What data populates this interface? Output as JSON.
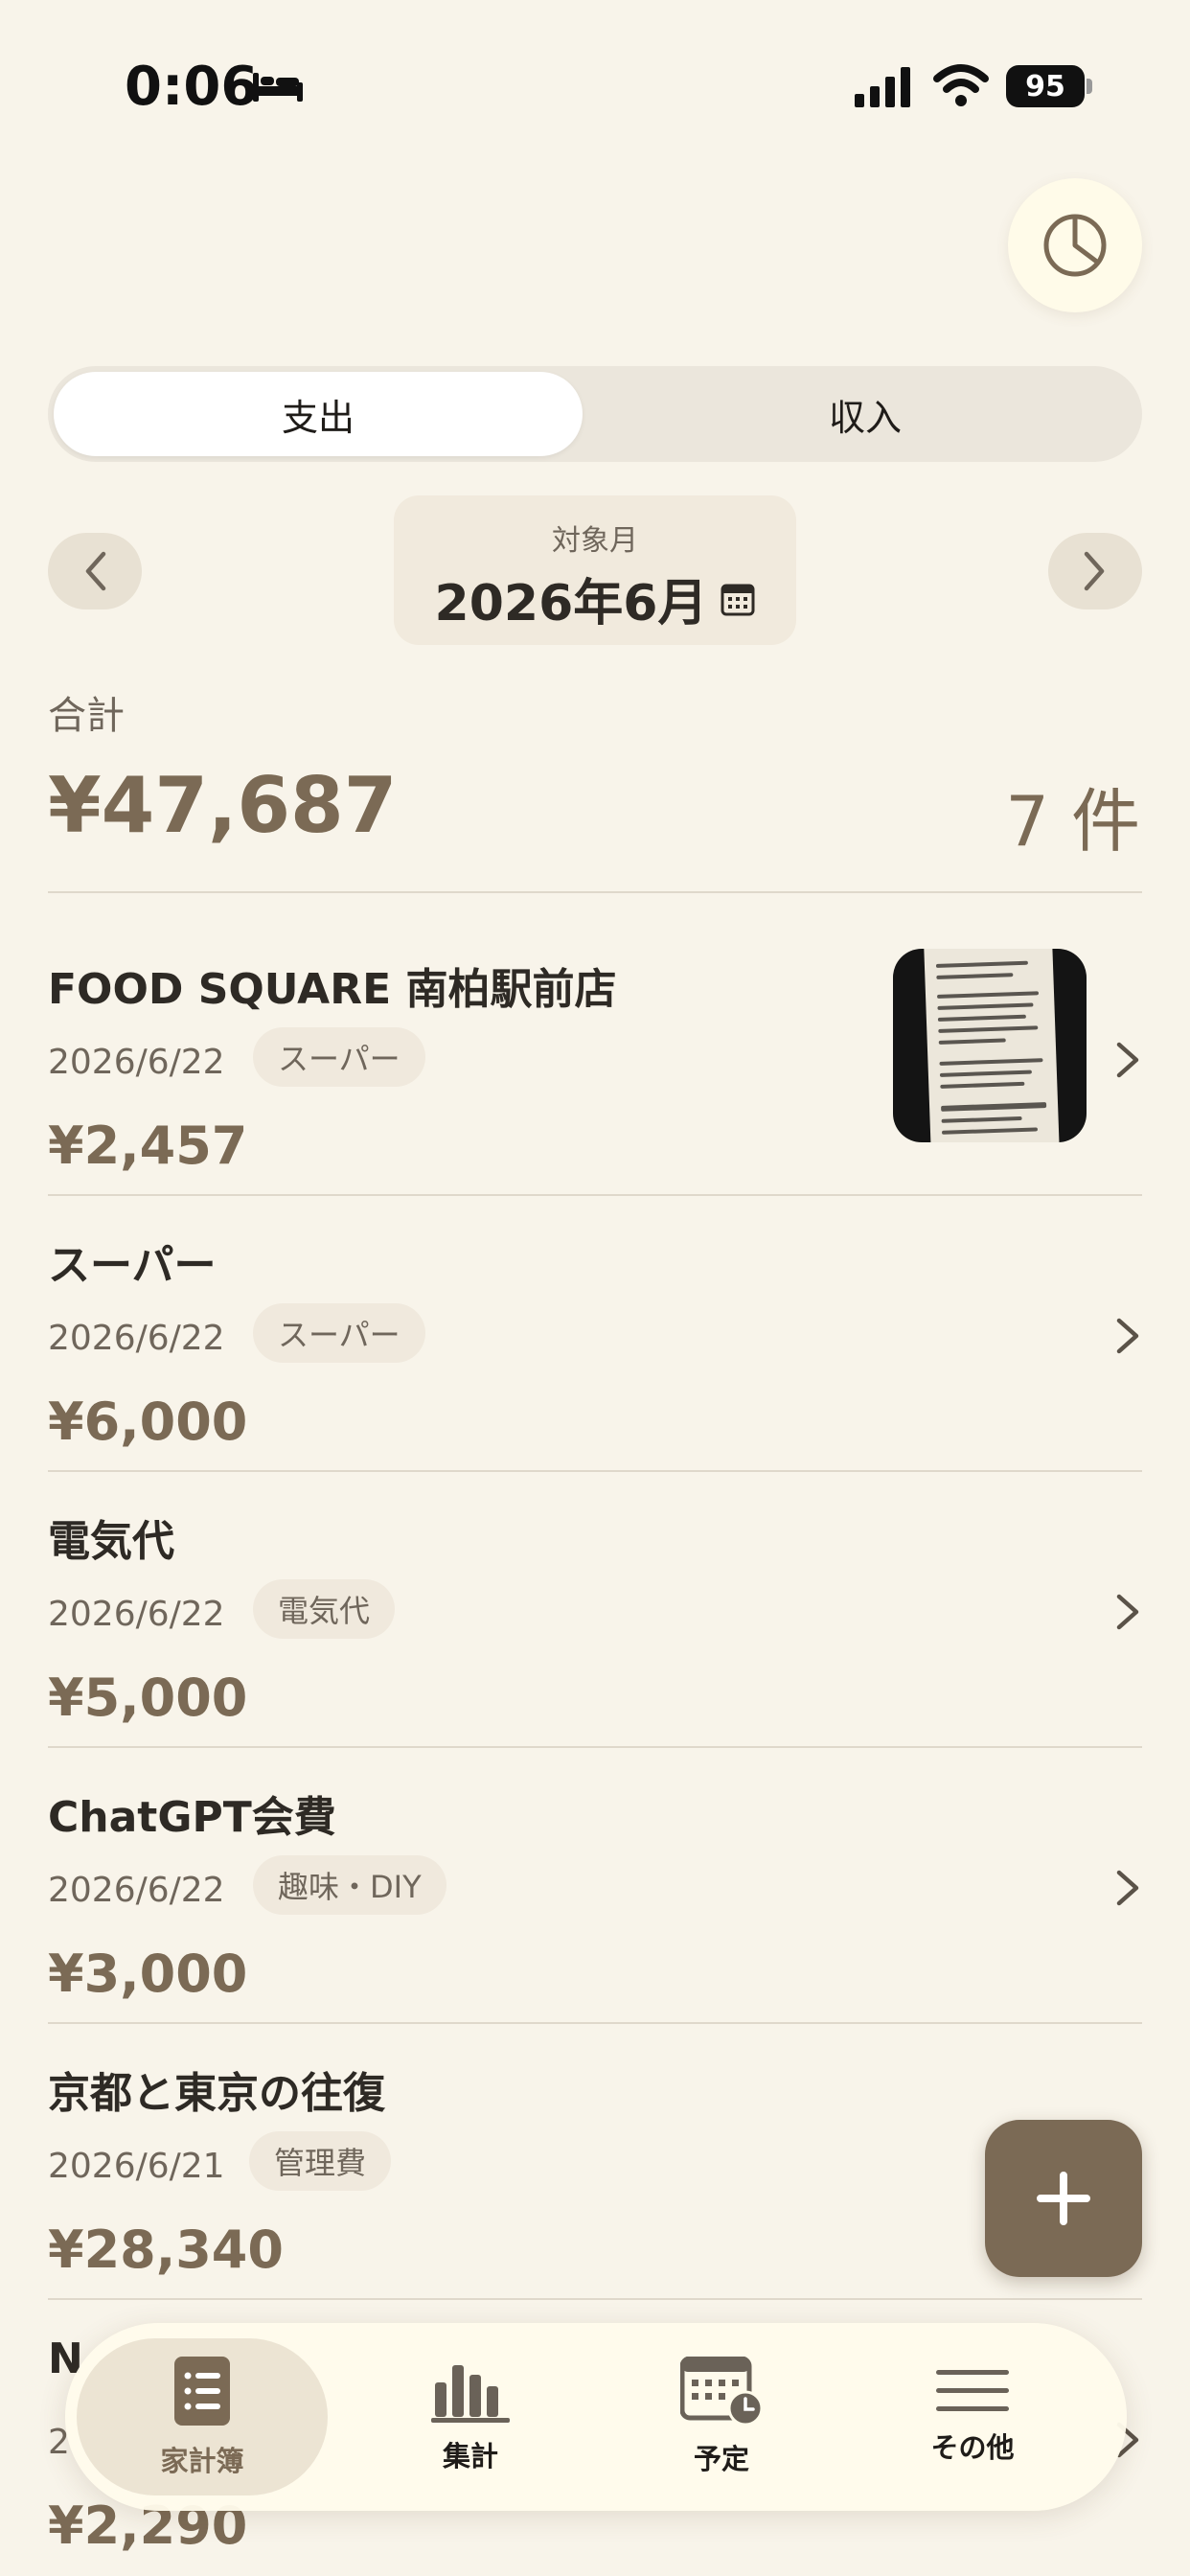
{
  "status_bar": {
    "time": "0:06",
    "battery": "95"
  },
  "segment": {
    "expense": "支出",
    "income": "収入"
  },
  "month": {
    "caption": "対象月",
    "value": "2026年6月"
  },
  "summary": {
    "label": "合計",
    "amount": "¥47,687",
    "count": "7 件"
  },
  "entries": [
    {
      "title": "FOOD SQUARE 南柏駅前店",
      "date": "2026/6/22",
      "category": "スーパー",
      "amount": "¥2,457",
      "has_receipt": true
    },
    {
      "title": "スーパー",
      "date": "2026/6/22",
      "category": "スーパー",
      "amount": "¥6,000"
    },
    {
      "title": "電気代",
      "date": "2026/6/22",
      "category": "電気代",
      "amount": "¥5,000"
    },
    {
      "title": "ChatGPT会費",
      "date": "2026/6/22",
      "category": "趣味・DIY",
      "amount": "¥3,000"
    },
    {
      "title": "京都と東京の往復",
      "date": "2026/6/21",
      "category": "管理費",
      "amount": "¥28,340"
    },
    {
      "title": "N",
      "date": "2",
      "amount": "¥2,290"
    }
  ],
  "tabs": [
    {
      "label": "家計簿",
      "icon": "household-book-icon",
      "active": true
    },
    {
      "label": "集計",
      "icon": "bar-chart-icon",
      "active": false
    },
    {
      "label": "予定",
      "icon": "calendar-clock-icon",
      "active": false
    },
    {
      "label": "その他",
      "icon": "menu-icon",
      "active": false
    }
  ],
  "colors": {
    "background": "#f8f4ea",
    "accent": "#7b6a55",
    "chip": "#f0e9dd",
    "tab_bar": "#fffbeb"
  }
}
